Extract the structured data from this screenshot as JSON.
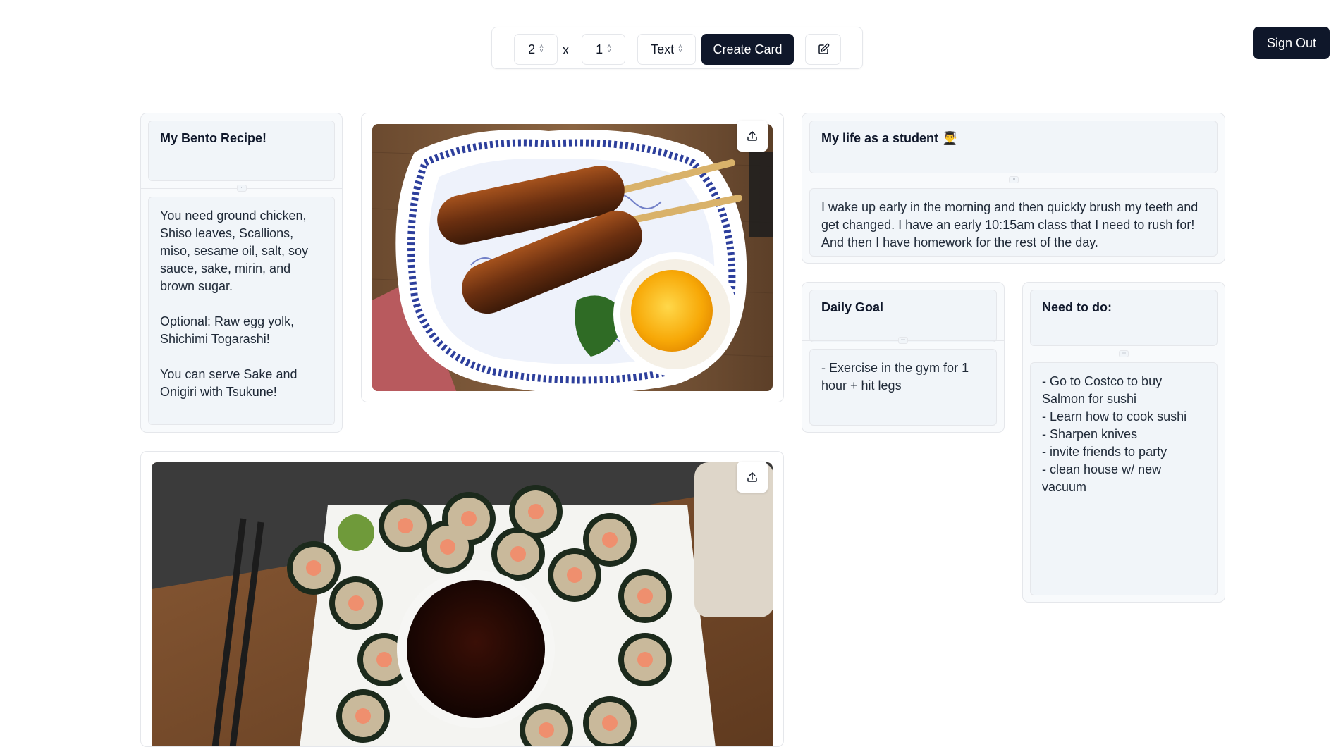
{
  "toolbar": {
    "rows_value": "2",
    "separator": "x",
    "cols_value": "1",
    "type_value": "Text",
    "create_label": "Create Card"
  },
  "header": {
    "signout_label": "Sign Out"
  },
  "cards": {
    "bento": {
      "title": "My Bento Recipe!",
      "body": "You need ground chicken, Shiso leaves, Scallions, miso, sesame oil, salt, soy sauce, sake, mirin, and brown sugar.\n\nOptional: Raw egg yolk, Shichimi Togarashi!\n\nYou can serve Sake  and Onigiri with Tsukune!"
    },
    "student": {
      "title": "My life as a student 👨‍🎓",
      "body": "I wake up early in the morning and then quickly brush my teeth and get changed. I have an early 10:15am class that I need to rush for! And then I have homework for the rest of the day."
    },
    "goal": {
      "title": "Daily Goal",
      "body": "- Exercise in the gym for 1 hour + hit legs"
    },
    "todo": {
      "title": "Need to do:",
      "body": "- Go to Costco to buy Salmon for sushi\n- Learn how to cook sushi\n- Sharpen knives\n- invite friends to party\n- clean house w/ new vacuum"
    }
  },
  "icons": {
    "chevron": "chevron-up-down-icon",
    "edit": "edit-icon",
    "upload": "upload-icon",
    "grip": "grip-icon"
  },
  "colors": {
    "primary": "#0f172a",
    "card_bg": "#f8fafc",
    "border": "#e5e7eb"
  }
}
